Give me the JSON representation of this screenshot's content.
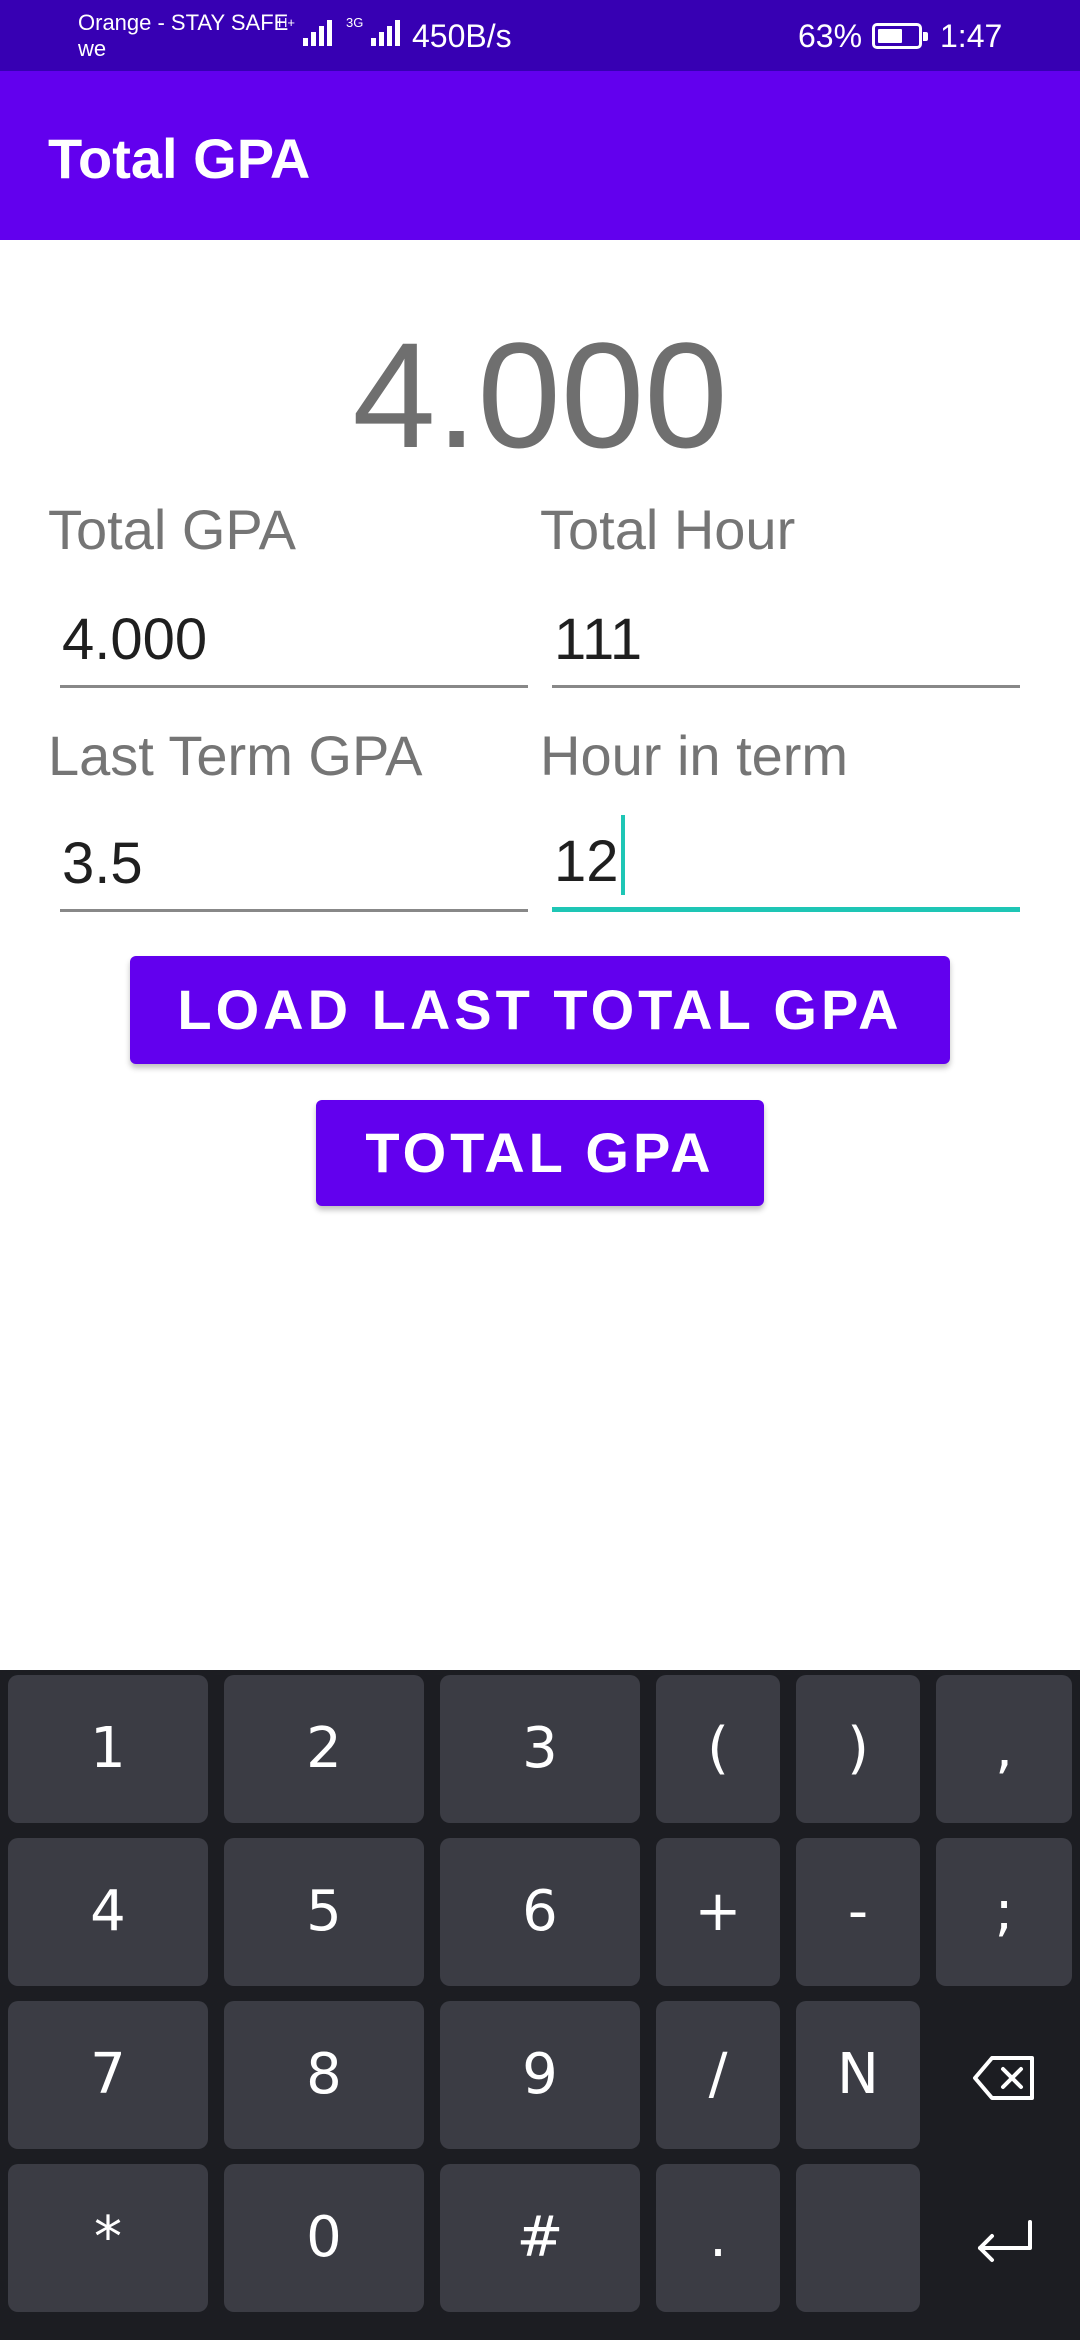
{
  "status_bar": {
    "carrier_line1": "Orange - STAY SAFE",
    "carrier_line2": "we",
    "net_tag_1": "H+",
    "net_tag_2": "3G",
    "net_speed": "450B/s",
    "battery_percent": "63%",
    "battery_level": 0.63,
    "time": "1:47",
    "icons": [
      "signal-icon",
      "signal-icon",
      "battery-icon"
    ]
  },
  "app_bar": {
    "title": "Total GPA"
  },
  "main": {
    "result": "4.000",
    "fields": [
      {
        "label": "Total GPA",
        "value": "4.000"
      },
      {
        "label": "Total Hour",
        "value": "111"
      },
      {
        "label": "Last Term GPA",
        "value": "3.5"
      },
      {
        "label": "Hour in term",
        "value": "12",
        "focused": true
      }
    ],
    "buttons": {
      "load_last": "LOAD LAST TOTAL GPA",
      "total": "TOTAL GPA"
    }
  },
  "keyboard": {
    "rows": [
      [
        "1",
        "2",
        "3",
        "(",
        ")",
        ","
      ],
      [
        "4",
        "5",
        "6",
        "+",
        "-",
        ";"
      ],
      [
        "7",
        "8",
        "9",
        "/",
        "N",
        "backspace-icon"
      ],
      [
        "*",
        "0",
        "#",
        ".",
        "",
        "enter-icon"
      ]
    ]
  },
  "colors": {
    "status_bar": "#3700b3",
    "primary": "#6200ee",
    "accent": "#1ec6b5",
    "keyboard_bg": "#1c1d22",
    "key_bg": "#3b3c44"
  }
}
